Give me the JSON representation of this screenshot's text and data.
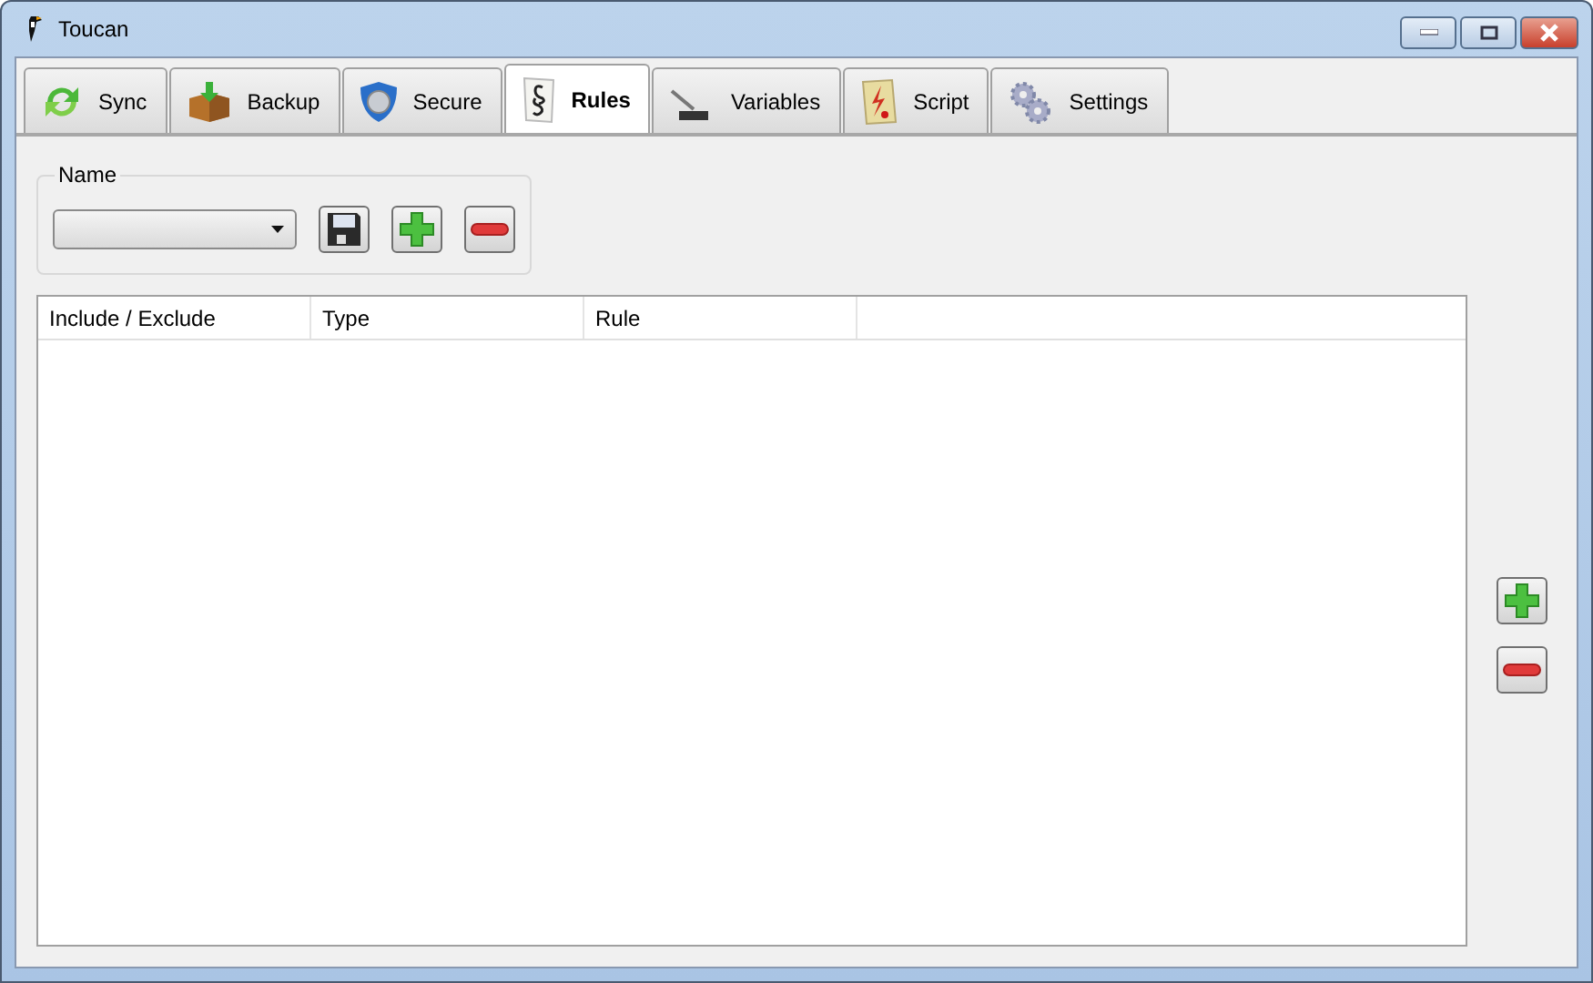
{
  "window": {
    "title": "Toucan"
  },
  "tabs": [
    {
      "label": "Sync",
      "selected": false
    },
    {
      "label": "Backup",
      "selected": false
    },
    {
      "label": "Secure",
      "selected": false
    },
    {
      "label": "Rules",
      "selected": true
    },
    {
      "label": "Variables",
      "selected": false
    },
    {
      "label": "Script",
      "selected": false
    },
    {
      "label": "Settings",
      "selected": false
    }
  ],
  "name_group": {
    "label": "Name"
  },
  "table": {
    "columns": [
      "Include / Exclude",
      "Type",
      "Rule"
    ]
  }
}
